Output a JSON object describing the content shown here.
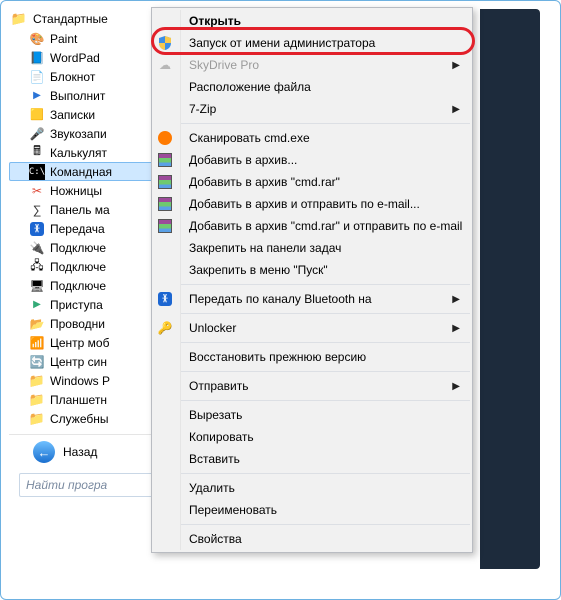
{
  "tree_root": "Стандартные",
  "tree": [
    {
      "label": "Paint",
      "icon": "paint"
    },
    {
      "label": "WordPad",
      "icon": "wordpad"
    },
    {
      "label": "Блокнот",
      "icon": "note"
    },
    {
      "label": "Выполнит",
      "icon": "run"
    },
    {
      "label": "Записки",
      "icon": "sticky"
    },
    {
      "label": "Звукозапи",
      "icon": "mic"
    },
    {
      "label": "Калькулят",
      "icon": "calc"
    },
    {
      "label": "Командная",
      "icon": "cmd",
      "selected": true
    },
    {
      "label": "Ножницы",
      "icon": "scissor"
    },
    {
      "label": "Панель ма",
      "icon": "math"
    },
    {
      "label": "Передача",
      "icon": "bt"
    },
    {
      "label": "Подключе",
      "icon": "net"
    },
    {
      "label": "Подключе",
      "icon": "net2"
    },
    {
      "label": "Подключе",
      "icon": "rdp"
    },
    {
      "label": "Приступа",
      "icon": "start"
    },
    {
      "label": "Проводни",
      "icon": "explorer"
    },
    {
      "label": "Центр моб",
      "icon": "mob"
    },
    {
      "label": "Центр син",
      "icon": "sync"
    },
    {
      "label": "Windows P",
      "icon": "folder"
    },
    {
      "label": "Планшетн",
      "icon": "folder"
    },
    {
      "label": "Служебны",
      "icon": "folder"
    }
  ],
  "back_label": "Назад",
  "search_placeholder": "Найти програ",
  "menu": [
    {
      "label": "Открыть",
      "bold": true
    },
    {
      "label": "Запуск от имени администратора",
      "icon": "shield",
      "highlighted": true
    },
    {
      "label": "SkyDrive Pro",
      "icon": "skydrive",
      "disabled": true,
      "submenu": true
    },
    {
      "label": "Расположение файла"
    },
    {
      "label": "7-Zip",
      "submenu": true
    },
    {
      "sep": true
    },
    {
      "label": "Сканировать cmd.exe",
      "icon": "avast"
    },
    {
      "label": "Добавить в архив...",
      "icon": "rar"
    },
    {
      "label": "Добавить в архив \"cmd.rar\"",
      "icon": "rar"
    },
    {
      "label": "Добавить в архив и отправить по e-mail...",
      "icon": "rar"
    },
    {
      "label": "Добавить в архив \"cmd.rar\" и отправить по e-mail",
      "icon": "rar"
    },
    {
      "label": "Закрепить на панели задач"
    },
    {
      "label": "Закрепить в меню \"Пуск\""
    },
    {
      "sep": true
    },
    {
      "label": "Передать по каналу Bluetooth на",
      "icon": "bluetooth",
      "submenu": true
    },
    {
      "sep": true
    },
    {
      "label": "Unlocker",
      "icon": "unlock",
      "submenu": true
    },
    {
      "sep": true
    },
    {
      "label": "Восстановить прежнюю версию"
    },
    {
      "sep": true
    },
    {
      "label": "Отправить",
      "submenu": true
    },
    {
      "sep": true
    },
    {
      "label": "Вырезать"
    },
    {
      "label": "Копировать"
    },
    {
      "label": "Вставить"
    },
    {
      "sep": true
    },
    {
      "label": "Удалить"
    },
    {
      "label": "Переименовать"
    },
    {
      "sep": true
    },
    {
      "label": "Свойства"
    }
  ]
}
